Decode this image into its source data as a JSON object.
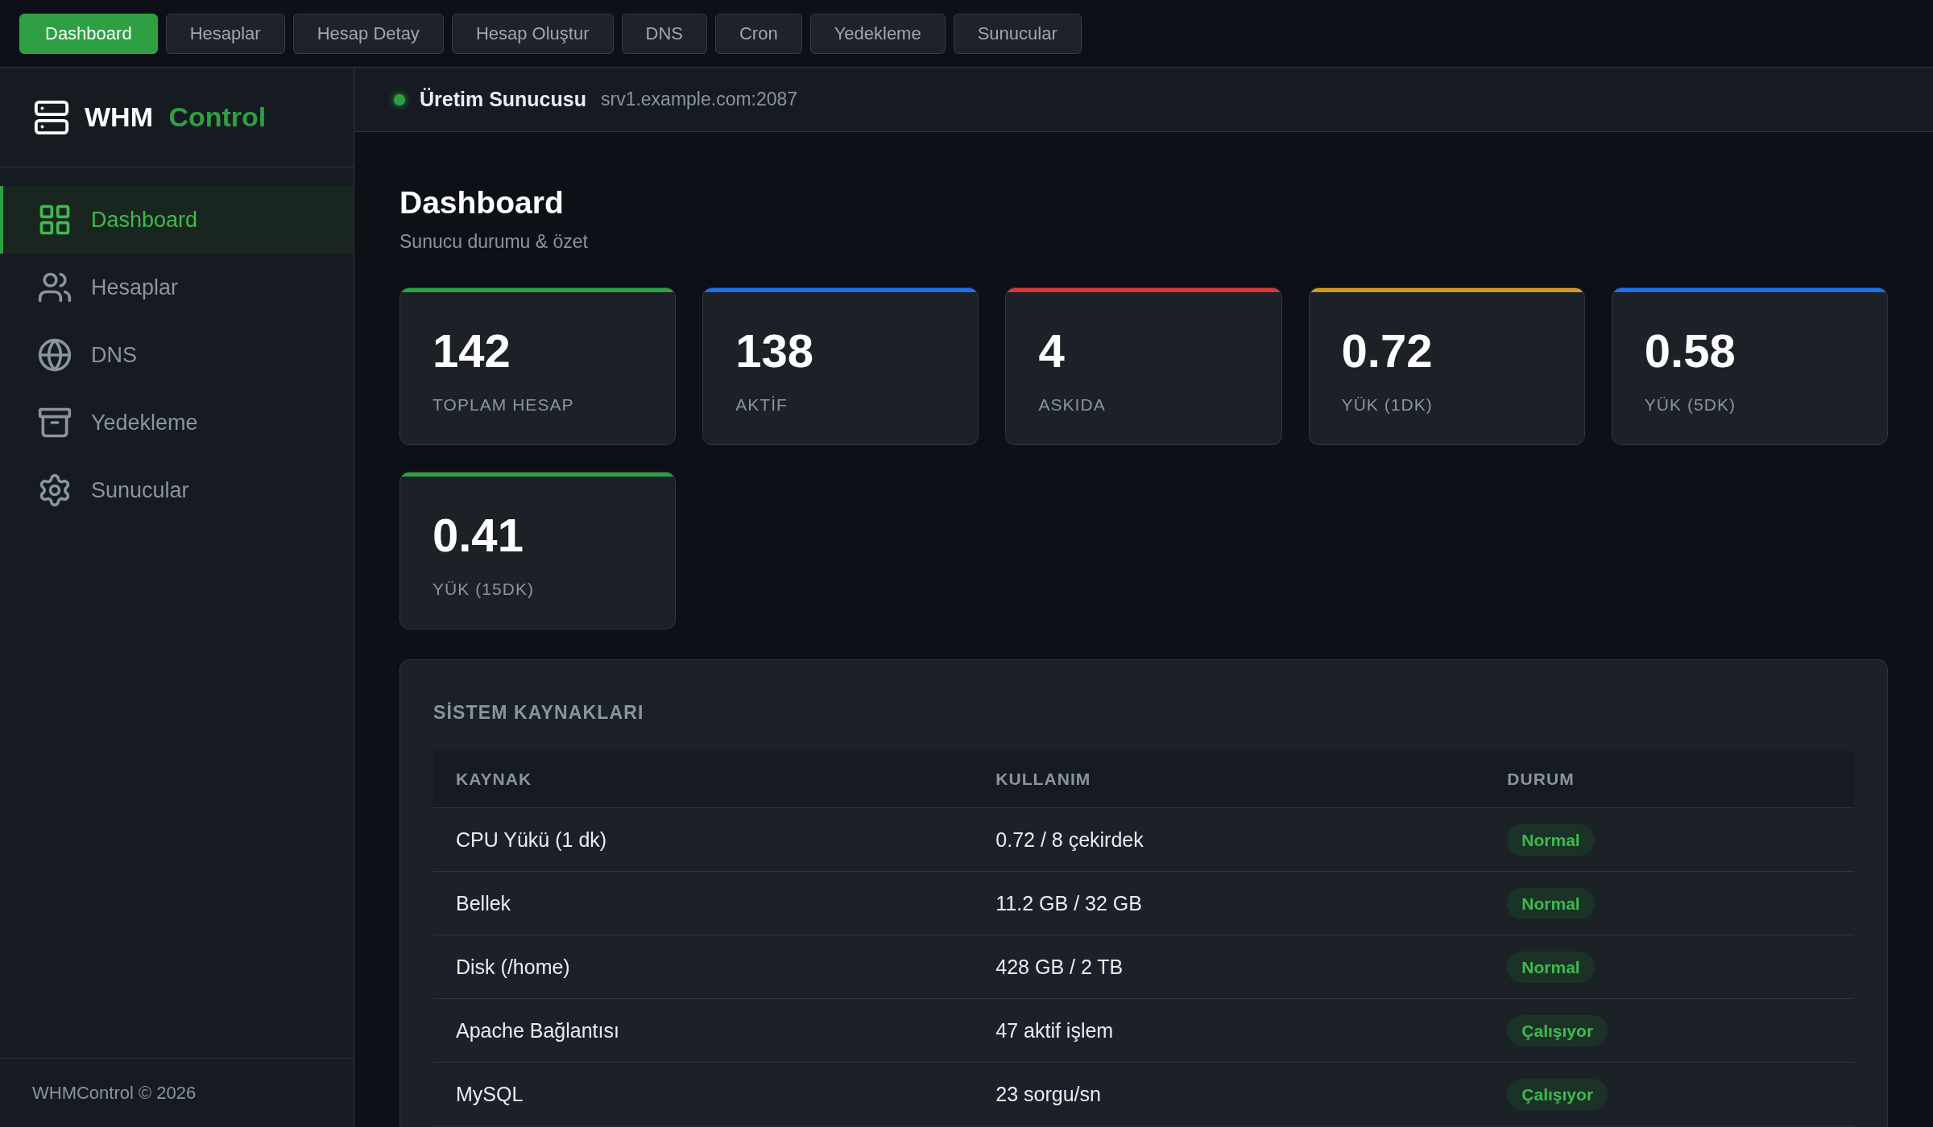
{
  "top_nav": [
    {
      "label": "Dashboard",
      "selected": true
    },
    {
      "label": "Hesaplar",
      "selected": false
    },
    {
      "label": "Hesap Detay",
      "selected": false
    },
    {
      "label": "Hesap Oluştur",
      "selected": false
    },
    {
      "label": "DNS",
      "selected": false
    },
    {
      "label": "Cron",
      "selected": false
    },
    {
      "label": "Yedekleme",
      "selected": false
    },
    {
      "label": "Sunucular",
      "selected": false
    }
  ],
  "sidebar": {
    "brand": {
      "name": "WHM",
      "accent": "Control"
    },
    "items": [
      {
        "label": "Dashboard",
        "selected": true
      },
      {
        "label": "Hesaplar",
        "selected": false
      },
      {
        "label": "DNS",
        "selected": false
      },
      {
        "label": "Yedekleme",
        "selected": false
      },
      {
        "label": "Sunucular",
        "selected": false
      }
    ],
    "footer": "WHMControl © 2026"
  },
  "server_bar": {
    "online": true,
    "name": "Üretim Sunucusu",
    "host": "srv1.example.com:2087"
  },
  "page": {
    "title": "Dashboard",
    "subtitle": "Sunucu durumu & özet"
  },
  "stats": [
    {
      "value": "142",
      "label": "TOPLAM HESAP",
      "color": "#2ea043"
    },
    {
      "value": "138",
      "label": "AKTİF",
      "color": "#1f6feb"
    },
    {
      "value": "4",
      "label": "ASKIDA",
      "color": "#da3633"
    },
    {
      "value": "0.72",
      "label": "YÜK (1DK)",
      "color": "#d29922"
    },
    {
      "value": "0.58",
      "label": "YÜK (5DK)",
      "color": "#1f6feb"
    },
    {
      "value": "0.41",
      "label": "YÜK (15DK)",
      "color": "#2ea043"
    }
  ],
  "resources_panel": {
    "title": "SİSTEM KAYNAKLARI",
    "table": {
      "columns": [
        "KAYNAK",
        "KULLANIM",
        "DURUM"
      ],
      "rows": [
        {
          "resource": "CPU Yükü (1 dk)",
          "usage": "0.72 / 8 çekirdek",
          "status": "Normal"
        },
        {
          "resource": "Bellek",
          "usage": "11.2 GB / 32 GB",
          "status": "Normal"
        },
        {
          "resource": "Disk (/home)",
          "usage": "428 GB / 2 TB",
          "status": "Normal"
        },
        {
          "resource": "Apache Bağlantısı",
          "usage": "47 aktif işlem",
          "status": "Çalışıyor"
        },
        {
          "resource": "MySQL",
          "usage": "23 sorgu/sn",
          "status": "Çalışıyor"
        }
      ]
    }
  }
}
